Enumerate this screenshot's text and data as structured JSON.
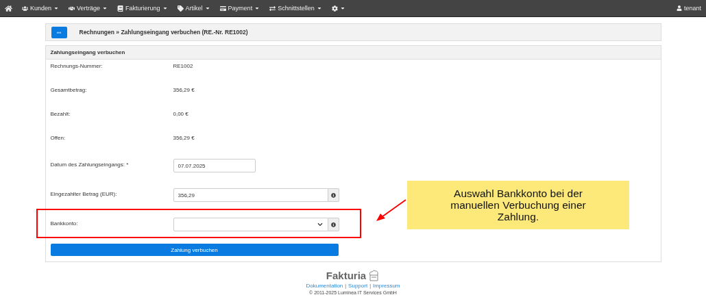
{
  "nav": {
    "items": [
      {
        "label": "Kunden"
      },
      {
        "label": "Verträge"
      },
      {
        "label": "Fakturierung"
      },
      {
        "label": "Artikel"
      },
      {
        "label": "Payment"
      },
      {
        "label": "Schnittstellen"
      }
    ],
    "user": "tenant"
  },
  "header": {
    "back_button": "««",
    "title": "Rechnungen » Zahlungseingang verbuchen (RE.-Nr. RE1002)"
  },
  "panel": {
    "title": "Zahlungseingang verbuchen",
    "info_rows": [
      {
        "label": "Rechnungs-Nummer:",
        "value": "RE1002"
      },
      {
        "label": "Gesamtbetrag:",
        "value": "356,29 €"
      },
      {
        "label": "Bezahlt:",
        "value": "0,00 €"
      },
      {
        "label": "Offen:",
        "value": "356,29 €"
      }
    ],
    "fields": [
      {
        "kind": "input",
        "label": "Datum des Zahlungseingangs: *",
        "value": "07.07.2025"
      },
      {
        "kind": "input_info",
        "label": "Eingezahlter Betrag (EUR):",
        "value": "356,29"
      },
      {
        "kind": "select_info",
        "label": "Bankkonto:"
      }
    ],
    "submit_button": "Zahlung verbuchen"
  },
  "annotation": {
    "text": "Auswahl Bankkonto bei der manuellen Verbuchung einer Zahlung."
  },
  "footer": {
    "logo": "Fakturia",
    "links": [
      "Dokumentation",
      "Support",
      "Impressum"
    ],
    "separator": "|",
    "copyright": "© 2011-2025 Luminea IT Services GmbH"
  }
}
